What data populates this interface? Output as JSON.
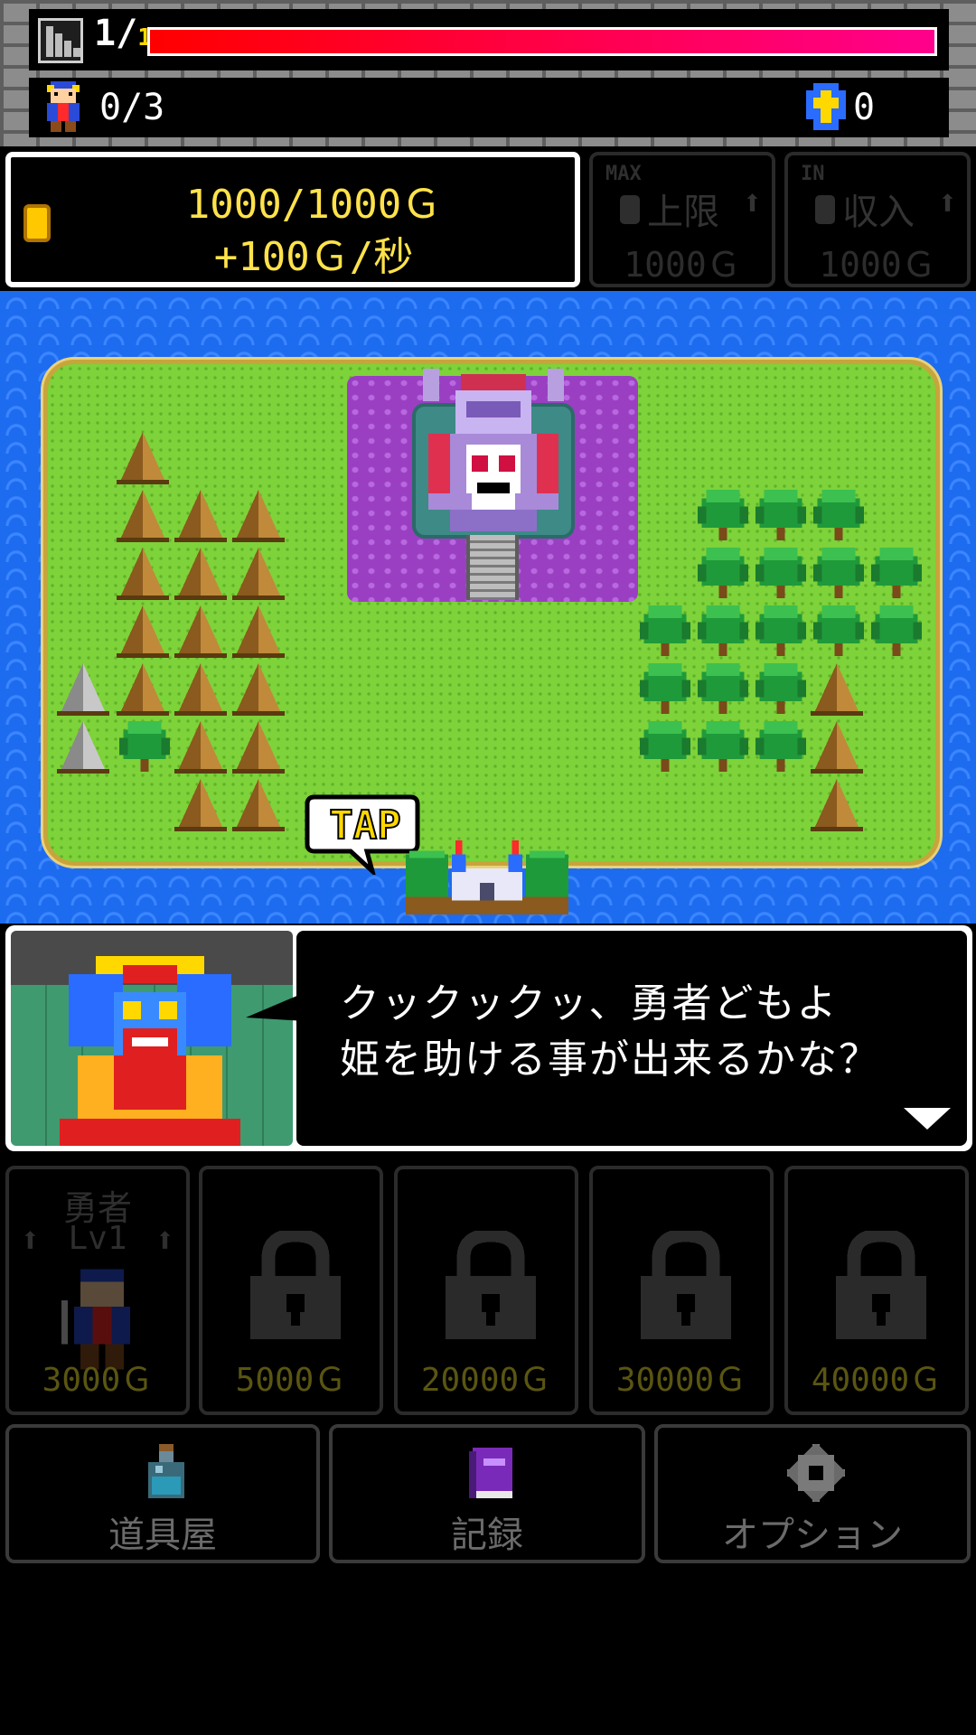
{
  "header": {
    "floor_current": "1",
    "floor_total": "1",
    "hp_fraction": 1.0,
    "party_count": "0/3",
    "cross_count": "0"
  },
  "gold": {
    "amount": "1000/1000Ｇ",
    "rate": "+100Ｇ/秒"
  },
  "upgrades": [
    {
      "tag": "MAX",
      "label": "上限",
      "price": "1000Ｇ",
      "icon": "coin-icon"
    },
    {
      "tag": "IN",
      "label": "収入",
      "price": "1000Ｇ",
      "icon": "coin-icon"
    }
  ],
  "map": {
    "tap_label": "TAP"
  },
  "dialogue": {
    "line1": "クックックッ、勇者どもよ",
    "line2": "姫を助ける事が出来るかな？"
  },
  "slots": [
    {
      "name": "勇者",
      "level": "Lv1",
      "price": "3000Ｇ",
      "locked": false
    },
    {
      "price": "5000Ｇ",
      "locked": true
    },
    {
      "price": "20000Ｇ",
      "locked": true
    },
    {
      "price": "30000Ｇ",
      "locked": true
    },
    {
      "price": "40000Ｇ",
      "locked": true
    }
  ],
  "menu": [
    {
      "label": "道具屋",
      "icon": "potion-icon"
    },
    {
      "label": "記録",
      "icon": "book-icon"
    },
    {
      "label": "オプション",
      "icon": "gear-icon"
    }
  ],
  "colors": {
    "gold_text": "#ffe24a",
    "hp_start": "#ff0000",
    "hp_end": "#ff008c",
    "sea": "#1d6cf0",
    "grass": "#7ed23a"
  }
}
